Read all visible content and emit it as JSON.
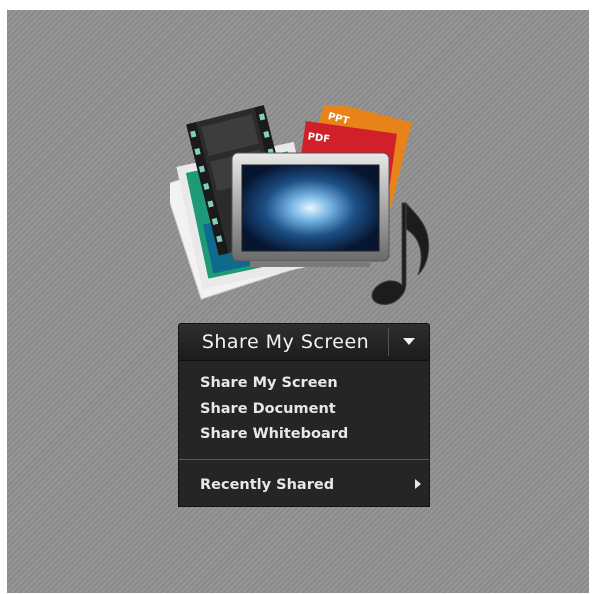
{
  "art": {
    "tags": [
      "PPT",
      "PDF"
    ]
  },
  "share_button": {
    "label": "Share My Screen",
    "dropdown_icon": "triangle-down-icon"
  },
  "menu": {
    "items": [
      {
        "label": "Share My Screen"
      },
      {
        "label": "Share Document"
      },
      {
        "label": "Share Whiteboard"
      }
    ],
    "recent": {
      "label": "Recently Shared",
      "icon": "chevron-right-icon"
    }
  },
  "colors": {
    "panel_bg": "#8f8f8f",
    "button_bg": "#262626",
    "menu_bg": "#252525",
    "text": "#e8e8e8",
    "ppt_tab": "#e8831a",
    "pdf_tab": "#d2202a"
  }
}
